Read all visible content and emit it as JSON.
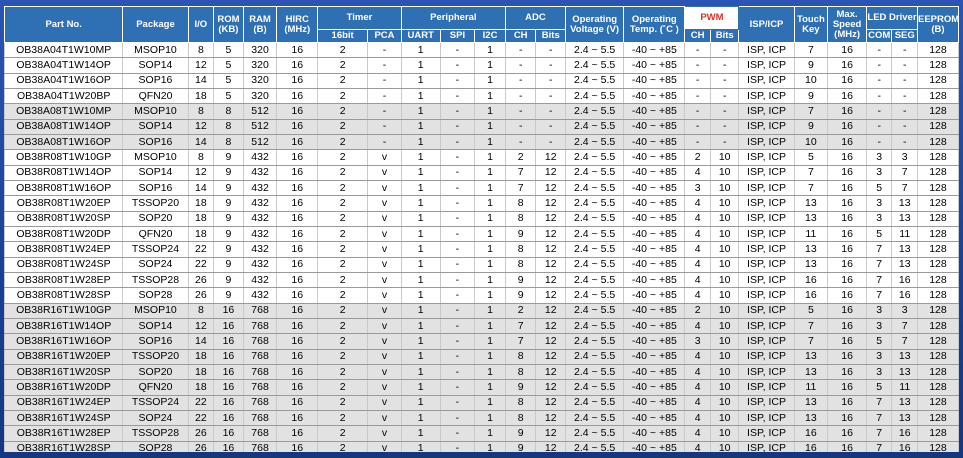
{
  "header": {
    "part_no": "Part No.",
    "package": "Package",
    "io": "I/O",
    "rom": "ROM (KB)",
    "ram": "RAM (B)",
    "hirc": "HIRC (MHz)",
    "timer": "Timer",
    "timer_16bit": "16bit",
    "timer_pca": "PCA",
    "peripheral": "Peripheral",
    "uart": "UART",
    "spi": "SPI",
    "i2c": "I2C",
    "adc": "ADC",
    "adc_ch": "CH",
    "adc_bits": "Bits",
    "voltage": "Operating Voltage (V)",
    "temp": "Operating Temp. (˚C )",
    "pwm": "PWM",
    "pwm_ch": "CH",
    "pwm_bits": "Bits",
    "isp": "ISP/ICP",
    "touch": "Touch Key",
    "speed": "Max. Speed (MHz)",
    "led": "LED Driver",
    "led_com": "COM",
    "led_seg": "SEG",
    "eeprom": "EEPROM (B)"
  },
  "rows": [
    {
      "shade": "white",
      "c": [
        "OB38A04T1W10MP",
        "MSOP10",
        "8",
        "5",
        "320",
        "16",
        "2",
        "-",
        "1",
        "-",
        "1",
        "-",
        "-",
        "2.4 ~ 5.5",
        "-40 ~ +85",
        "-",
        "-",
        "ISP, ICP",
        "7",
        "16",
        "-",
        "-",
        "128"
      ]
    },
    {
      "shade": "white",
      "c": [
        "OB38A04T1W14OP",
        "SOP14",
        "12",
        "5",
        "320",
        "16",
        "2",
        "-",
        "1",
        "-",
        "1",
        "-",
        "-",
        "2.4 ~ 5.5",
        "-40 ~ +85",
        "-",
        "-",
        "ISP, ICP",
        "9",
        "16",
        "-",
        "-",
        "128"
      ]
    },
    {
      "shade": "white",
      "c": [
        "OB38A04T1W16OP",
        "SOP16",
        "14",
        "5",
        "320",
        "16",
        "2",
        "-",
        "1",
        "-",
        "1",
        "-",
        "-",
        "2.4 ~ 5.5",
        "-40 ~ +85",
        "-",
        "-",
        "ISP, ICP",
        "10",
        "16",
        "-",
        "-",
        "128"
      ]
    },
    {
      "shade": "white",
      "c": [
        "OB38A04T1W20BP",
        "QFN20",
        "18",
        "5",
        "320",
        "16",
        "2",
        "-",
        "1",
        "-",
        "1",
        "-",
        "-",
        "2.4 ~ 5.5",
        "-40 ~ +85",
        "-",
        "-",
        "ISP, ICP",
        "9",
        "16",
        "-",
        "-",
        "128"
      ]
    },
    {
      "shade": "gray",
      "c": [
        "OB38A08T1W10MP",
        "MSOP10",
        "8",
        "8",
        "512",
        "16",
        "2",
        "-",
        "1",
        "-",
        "1",
        "-",
        "-",
        "2.4 ~ 5.5",
        "-40 ~ +85",
        "-",
        "-",
        "ISP, ICP",
        "7",
        "16",
        "-",
        "-",
        "128"
      ]
    },
    {
      "shade": "gray",
      "c": [
        "OB38A08T1W14OP",
        "SOP14",
        "12",
        "8",
        "512",
        "16",
        "2",
        "-",
        "1",
        "-",
        "1",
        "-",
        "-",
        "2.4 ~ 5.5",
        "-40 ~ +85",
        "-",
        "-",
        "ISP, ICP",
        "9",
        "16",
        "-",
        "-",
        "128"
      ]
    },
    {
      "shade": "gray",
      "c": [
        "OB38A08T1W16OP",
        "SOP16",
        "14",
        "8",
        "512",
        "16",
        "2",
        "-",
        "1",
        "-",
        "1",
        "-",
        "-",
        "2.4 ~ 5.5",
        "-40 ~ +85",
        "-",
        "-",
        "ISP, ICP",
        "10",
        "16",
        "-",
        "-",
        "128"
      ]
    },
    {
      "shade": "white",
      "c": [
        "OB38R08T1W10GP",
        "MSOP10",
        "8",
        "9",
        "432",
        "16",
        "2",
        "v",
        "1",
        "-",
        "1",
        "2",
        "12",
        "2.4 ~ 5.5",
        "-40 ~ +85",
        "2",
        "10",
        "ISP, ICP",
        "5",
        "16",
        "3",
        "3",
        "128"
      ]
    },
    {
      "shade": "white",
      "c": [
        "OB38R08T1W14OP",
        "SOP14",
        "12",
        "9",
        "432",
        "16",
        "2",
        "v",
        "1",
        "-",
        "1",
        "7",
        "12",
        "2.4 ~ 5.5",
        "-40 ~ +85",
        "4",
        "10",
        "ISP, ICP",
        "7",
        "16",
        "3",
        "7",
        "128"
      ]
    },
    {
      "shade": "white",
      "c": [
        "OB38R08T1W16OP",
        "SOP16",
        "14",
        "9",
        "432",
        "16",
        "2",
        "v",
        "1",
        "-",
        "1",
        "7",
        "12",
        "2.4 ~ 5.5",
        "-40 ~ +85",
        "3",
        "10",
        "ISP, ICP",
        "7",
        "16",
        "5",
        "7",
        "128"
      ]
    },
    {
      "shade": "white",
      "c": [
        "OB38R08T1W20EP",
        "TSSOP20",
        "18",
        "9",
        "432",
        "16",
        "2",
        "v",
        "1",
        "-",
        "1",
        "8",
        "12",
        "2.4 ~ 5.5",
        "-40 ~ +85",
        "4",
        "10",
        "ISP, ICP",
        "13",
        "16",
        "3",
        "13",
        "128"
      ]
    },
    {
      "shade": "white",
      "c": [
        "OB38R08T1W20SP",
        "SOP20",
        "18",
        "9",
        "432",
        "16",
        "2",
        "v",
        "1",
        "-",
        "1",
        "8",
        "12",
        "2.4 ~ 5.5",
        "-40 ~ +85",
        "4",
        "10",
        "ISP, ICP",
        "13",
        "16",
        "3",
        "13",
        "128"
      ]
    },
    {
      "shade": "white",
      "c": [
        "OB38R08T1W20DP",
        "QFN20",
        "18",
        "9",
        "432",
        "16",
        "2",
        "v",
        "1",
        "-",
        "1",
        "9",
        "12",
        "2.4 ~ 5.5",
        "-40 ~ +85",
        "4",
        "10",
        "ISP, ICP",
        "11",
        "16",
        "5",
        "11",
        "128"
      ]
    },
    {
      "shade": "white",
      "c": [
        "OB38R08T1W24EP",
        "TSSOP24",
        "22",
        "9",
        "432",
        "16",
        "2",
        "v",
        "1",
        "-",
        "1",
        "8",
        "12",
        "2.4 ~ 5.5",
        "-40 ~ +85",
        "4",
        "10",
        "ISP, ICP",
        "13",
        "16",
        "7",
        "13",
        "128"
      ]
    },
    {
      "shade": "white",
      "c": [
        "OB38R08T1W24SP",
        "SOP24",
        "22",
        "9",
        "432",
        "16",
        "2",
        "v",
        "1",
        "-",
        "1",
        "8",
        "12",
        "2.4 ~ 5.5",
        "-40 ~ +85",
        "4",
        "10",
        "ISP, ICP",
        "13",
        "16",
        "7",
        "13",
        "128"
      ]
    },
    {
      "shade": "white",
      "c": [
        "OB38R08T1W28EP",
        "TSSOP28",
        "26",
        "9",
        "432",
        "16",
        "2",
        "v",
        "1",
        "-",
        "1",
        "9",
        "12",
        "2.4 ~ 5.5",
        "-40 ~ +85",
        "4",
        "10",
        "ISP, ICP",
        "16",
        "16",
        "7",
        "16",
        "128"
      ]
    },
    {
      "shade": "white",
      "c": [
        "OB38R08T1W28SP",
        "SOP28",
        "26",
        "9",
        "432",
        "16",
        "2",
        "v",
        "1",
        "-",
        "1",
        "9",
        "12",
        "2.4 ~ 5.5",
        "-40 ~ +85",
        "4",
        "10",
        "ISP, ICP",
        "16",
        "16",
        "7",
        "16",
        "128"
      ]
    },
    {
      "shade": "gray",
      "c": [
        "OB38R16T1W10GP",
        "MSOP10",
        "8",
        "16",
        "768",
        "16",
        "2",
        "v",
        "1",
        "-",
        "1",
        "2",
        "12",
        "2.4 ~ 5.5",
        "-40 ~ +85",
        "2",
        "10",
        "ISP, ICP",
        "5",
        "16",
        "3",
        "3",
        "128"
      ]
    },
    {
      "shade": "gray",
      "c": [
        "OB38R16T1W14OP",
        "SOP14",
        "12",
        "16",
        "768",
        "16",
        "2",
        "v",
        "1",
        "-",
        "1",
        "7",
        "12",
        "2.4 ~ 5.5",
        "-40 ~ +85",
        "4",
        "10",
        "ISP, ICP",
        "7",
        "16",
        "3",
        "7",
        "128"
      ]
    },
    {
      "shade": "gray",
      "c": [
        "OB38R16T1W16OP",
        "SOP16",
        "14",
        "16",
        "768",
        "16",
        "2",
        "v",
        "1",
        "-",
        "1",
        "7",
        "12",
        "2.4 ~ 5.5",
        "-40 ~ +85",
        "3",
        "10",
        "ISP, ICP",
        "7",
        "16",
        "5",
        "7",
        "128"
      ]
    },
    {
      "shade": "gray",
      "c": [
        "OB38R16T1W20EP",
        "TSSOP20",
        "18",
        "16",
        "768",
        "16",
        "2",
        "v",
        "1",
        "-",
        "1",
        "8",
        "12",
        "2.4 ~ 5.5",
        "-40 ~ +85",
        "4",
        "10",
        "ISP, ICP",
        "13",
        "16",
        "3",
        "13",
        "128"
      ]
    },
    {
      "shade": "gray",
      "c": [
        "OB38R16T1W20SP",
        "SOP20",
        "18",
        "16",
        "768",
        "16",
        "2",
        "v",
        "1",
        "-",
        "1",
        "8",
        "12",
        "2.4 ~ 5.5",
        "-40 ~ +85",
        "4",
        "10",
        "ISP, ICP",
        "13",
        "16",
        "3",
        "13",
        "128"
      ]
    },
    {
      "shade": "gray",
      "c": [
        "OB38R16T1W20DP",
        "QFN20",
        "18",
        "16",
        "768",
        "16",
        "2",
        "v",
        "1",
        "-",
        "1",
        "9",
        "12",
        "2.4 ~ 5.5",
        "-40 ~ +85",
        "4",
        "10",
        "ISP, ICP",
        "11",
        "16",
        "5",
        "11",
        "128"
      ]
    },
    {
      "shade": "gray",
      "c": [
        "OB38R16T1W24EP",
        "TSSOP24",
        "22",
        "16",
        "768",
        "16",
        "2",
        "v",
        "1",
        "-",
        "1",
        "8",
        "12",
        "2.4 ~ 5.5",
        "-40 ~ +85",
        "4",
        "10",
        "ISP, ICP",
        "13",
        "16",
        "7",
        "13",
        "128"
      ]
    },
    {
      "shade": "gray",
      "c": [
        "OB38R16T1W24SP",
        "SOP24",
        "22",
        "16",
        "768",
        "16",
        "2",
        "v",
        "1",
        "-",
        "1",
        "8",
        "12",
        "2.4 ~ 5.5",
        "-40 ~ +85",
        "4",
        "10",
        "ISP, ICP",
        "13",
        "16",
        "7",
        "13",
        "128"
      ]
    },
    {
      "shade": "gray",
      "c": [
        "OB38R16T1W28EP",
        "TSSOP28",
        "26",
        "16",
        "768",
        "16",
        "2",
        "v",
        "1",
        "-",
        "1",
        "9",
        "12",
        "2.4 ~ 5.5",
        "-40 ~ +85",
        "4",
        "10",
        "ISP, ICP",
        "16",
        "16",
        "7",
        "16",
        "128"
      ]
    },
    {
      "shade": "gray",
      "c": [
        "OB38R16T1W28SP",
        "SOP28",
        "26",
        "16",
        "768",
        "16",
        "2",
        "v",
        "1",
        "-",
        "1",
        "9",
        "12",
        "2.4 ~ 5.5",
        "-40 ~ +85",
        "4",
        "10",
        "ISP, ICP",
        "16",
        "16",
        "7",
        "16",
        "128"
      ]
    },
    {
      "shade": "white",
      "c": [
        "OB38S013W20EP",
        "TSSOP20",
        "18",
        "16",
        "768",
        "16",
        "2",
        "v",
        "1",
        "-",
        "1",
        "9",
        "12",
        "2.4 ~ 5.5",
        "-40 ~ +85",
        "4",
        "10",
        "ISP, ICP",
        "11",
        "16",
        "5",
        "11",
        "128"
      ]
    }
  ]
}
